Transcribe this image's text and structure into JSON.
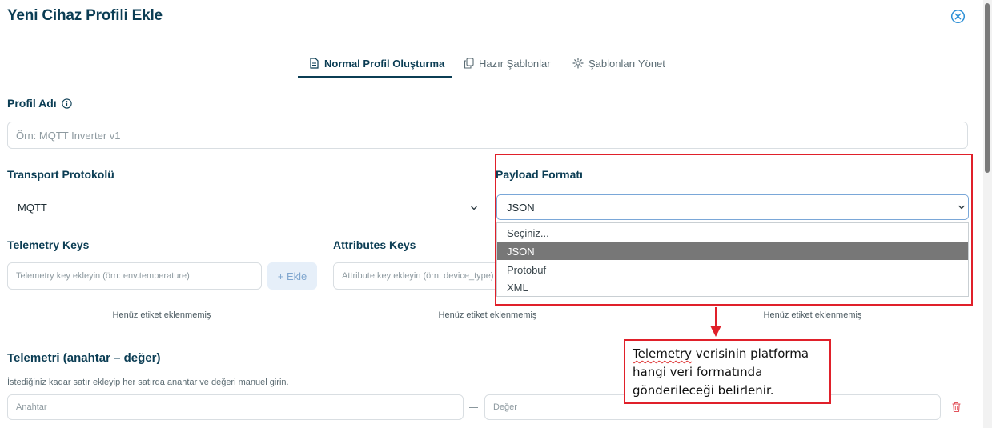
{
  "dialog": {
    "title": "Yeni Cihaz Profili Ekle",
    "close_icon": "close-circle-icon"
  },
  "tabs": [
    {
      "label": "Normal Profil Oluşturma",
      "icon": "document-icon",
      "active": true
    },
    {
      "label": "Hazır Şablonlar",
      "icon": "copy-icon",
      "active": false
    },
    {
      "label": "Şablonları Yönet",
      "icon": "gear-icon",
      "active": false
    }
  ],
  "profile_name": {
    "label": "Profil Adı",
    "info_icon": "info-icon",
    "placeholder": "Örn: MQTT Inverter v1",
    "value": ""
  },
  "transport": {
    "label": "Transport Protokolü",
    "value": "MQTT"
  },
  "payload": {
    "label": "Payload Formatı",
    "value": "JSON",
    "options": [
      "Seçiniz...",
      "JSON",
      "Protobuf",
      "XML"
    ],
    "selected_index": 1
  },
  "telemetry_keys": {
    "label": "Telemetry Keys",
    "placeholder": "Telemetry key ekleyin (örn: env.temperature)",
    "add_button": "+ Ekle",
    "empty_text": "Henüz etiket eklenmemiş"
  },
  "attributes_keys": {
    "label": "Attributes Keys",
    "placeholder": "Attribute key ekleyin (örn: device_type)",
    "empty_text": "Henüz etiket eklenmemiş"
  },
  "third_keys": {
    "empty_text": "Henüz etiket eklenmemiş"
  },
  "telemetry_kv": {
    "label": "Telemetri (anahtar – değer)",
    "description": "İstediğiniz kadar satır ekleyip her satırda anahtar ve değeri manuel girin.",
    "key_placeholder": "Anahtar",
    "value_placeholder": "Değer",
    "delete_icon": "trash-icon"
  },
  "annotation": {
    "callout_word": "Telemetry",
    "callout_rest": " verisinin platforma hangi veri formatında gönderileceği belirlenir.",
    "color": "#e0202a"
  },
  "colors": {
    "primary": "#0b3d54",
    "selected_option_bg": "#777777",
    "focus_border": "#7aa7d8"
  }
}
